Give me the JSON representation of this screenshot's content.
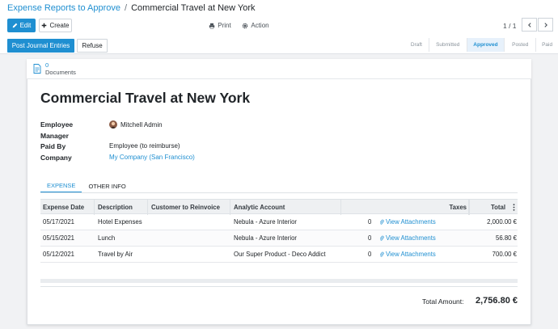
{
  "breadcrumb": {
    "parent": "Expense Reports to Approve",
    "separator": "/",
    "current": "Commercial Travel at New York"
  },
  "toolbar": {
    "edit_label": "Edit",
    "create_label": "Create",
    "print_label": "Print",
    "action_label": "Action"
  },
  "pager": {
    "value": "1 / 1"
  },
  "header_buttons": {
    "post_label": "Post Journal Entries",
    "refuse_label": "Refuse"
  },
  "status": {
    "stages": [
      "Draft",
      "Submitted",
      "Approved",
      "Posted",
      "Paid"
    ],
    "active": "Approved"
  },
  "smart_button": {
    "count": "0",
    "label": "Documents"
  },
  "record": {
    "title": "Commercial Travel at New York",
    "employee_label": "Employee",
    "employee_value": "Mitchell Admin",
    "manager_label": "Manager",
    "paid_by_label": "Paid By",
    "paid_by_value": "Employee (to reimburse)",
    "company_label": "Company",
    "company_value": "My Company (San Francisco)"
  },
  "tabs": [
    "EXPENSE",
    "OTHER INFO"
  ],
  "table": {
    "columns": [
      "Expense Date",
      "Description",
      "Customer to Reinvoice",
      "Analytic Account",
      "Taxes",
      "Total"
    ],
    "rows": [
      {
        "date": "05/17/2021",
        "description": "Hotel Expenses",
        "customer": "",
        "analytic": "Nebula - Azure Interior",
        "count": "0",
        "attach": "View Attachments",
        "taxes": "",
        "total": "2,000.00 €"
      },
      {
        "date": "05/15/2021",
        "description": "Lunch",
        "customer": "",
        "analytic": "Nebula - Azure Interior",
        "count": "0",
        "attach": "View Attachments",
        "taxes": "",
        "total": "56.80 €"
      },
      {
        "date": "05/12/2021",
        "description": "Travel by Air",
        "customer": "",
        "analytic": "Our Super Product - Deco Addict",
        "count": "0",
        "attach": "View Attachments",
        "taxes": "",
        "total": "700.00 €"
      }
    ]
  },
  "totals": {
    "label": "Total Amount:",
    "value": "2,756.80 €"
  },
  "colors": {
    "primary": "#1f8fd1",
    "status_active_bg": "#e7f1fb"
  }
}
